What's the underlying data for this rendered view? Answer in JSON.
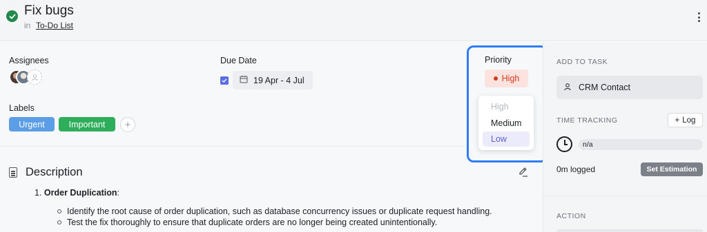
{
  "task": {
    "title": "Fix bugs",
    "in_label": "in",
    "list_name": "To-Do List"
  },
  "fields": {
    "assignees_label": "Assignees",
    "due_date_label": "Due Date",
    "due_date_value": "19 Apr - 4 Jul",
    "labels_label": "Labels",
    "tags": [
      "Urgent",
      "Important"
    ]
  },
  "priority": {
    "label": "Priority",
    "current": "High",
    "options": [
      "High",
      "Medium",
      "Low"
    ],
    "highlighted_option": "Low"
  },
  "description": {
    "title": "Description",
    "item_number": "1.",
    "item_title": "Order Duplication",
    "item_suffix": ":",
    "bullets": [
      "Identify the root cause of order duplication, such as database concurrency issues or duplicate request handling.",
      "Test the fix thoroughly to ensure that duplicate orders are no longer being created unintentionally."
    ]
  },
  "sidebar": {
    "add_to_task": "ADD TO TASK",
    "crm_contact": "CRM Contact",
    "time_tracking": "TIME TRACKING",
    "log_button": "Log",
    "tracked_value": "n/a",
    "logged_text": "0m logged",
    "set_estimation": "Set Estimation",
    "action": "ACTION"
  },
  "colors": {
    "status_done": "#1f8a4c",
    "tag_urgent": "#5b9ee6",
    "tag_important": "#2eae5b",
    "priority_high": "#d13b1d",
    "highlight_border": "#2f7df5"
  }
}
